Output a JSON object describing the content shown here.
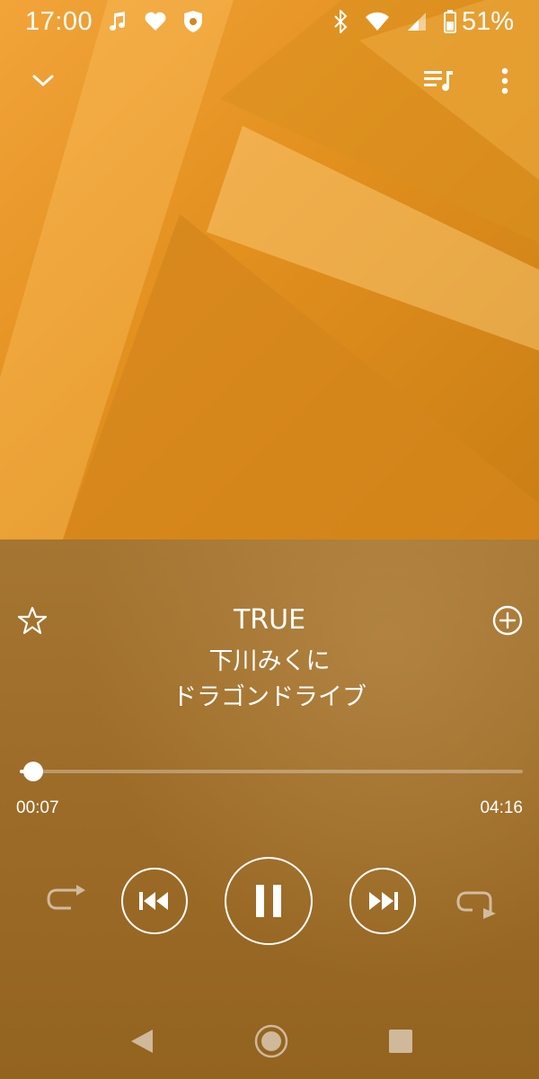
{
  "status_bar": {
    "time": "17:00",
    "battery_percent": "51%",
    "left_icons": [
      "music-note-icon",
      "heart-icon",
      "bug-shield-icon"
    ],
    "right_icons": [
      "bluetooth-icon",
      "wifi-icon",
      "signal-icon",
      "battery-icon"
    ]
  },
  "app_bar": {
    "icons": [
      "chevron-down-icon",
      "queue-music-icon",
      "more-vert-icon"
    ]
  },
  "track": {
    "title": "TRUE",
    "artist": "下川みくに",
    "album": "ドラゴンドライブ"
  },
  "progress": {
    "elapsed": "00:07",
    "total": "04:16",
    "fraction": 0.027
  },
  "controls": {
    "state": "playing",
    "icons": [
      "repeat-icon",
      "skip-previous-icon",
      "pause-icon",
      "skip-next-icon",
      "shuffle-icon"
    ]
  },
  "nav_bar": {
    "icons": [
      "back-icon",
      "home-icon",
      "recents-icon"
    ]
  },
  "colors": {
    "art_orange": "#e2901e",
    "panel_brown": "#9d6c28",
    "foreground": "#ffffff"
  }
}
